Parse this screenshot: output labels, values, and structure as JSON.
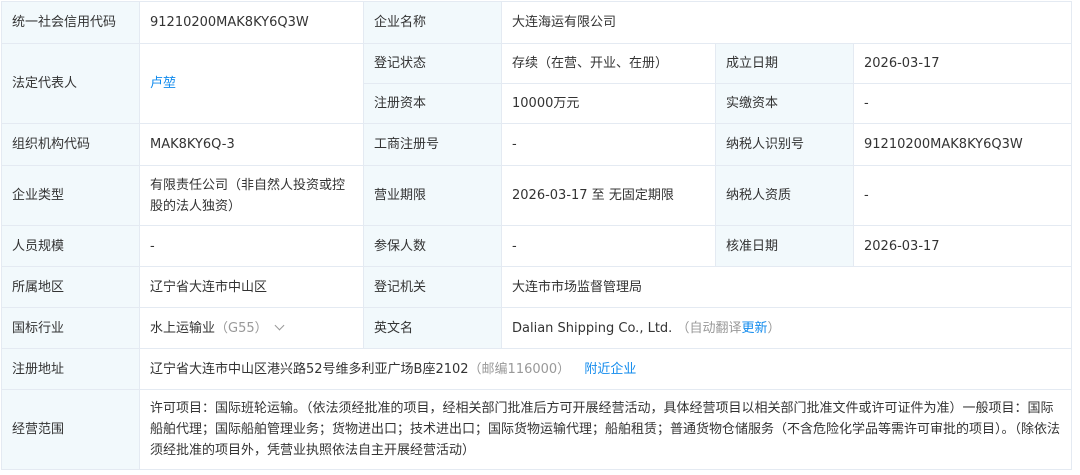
{
  "rows": {
    "credit_code": {
      "label": "统一社会信用代码",
      "value": "91210200MAK8KY6Q3W"
    },
    "company_name": {
      "label": "企业名称",
      "value": "大连海运有限公司"
    },
    "legal_rep": {
      "label": "法定代表人",
      "value": "卢堃"
    },
    "reg_status": {
      "label": "登记状态",
      "value": "存续（在营、开业、在册）"
    },
    "founded": {
      "label": "成立日期",
      "value": "2026-03-17"
    },
    "reg_capital": {
      "label": "注册资本",
      "value": "10000万元"
    },
    "paid_capital": {
      "label": "实缴资本",
      "value": "-"
    },
    "org_code": {
      "label": "组织机构代码",
      "value": "MAK8KY6Q-3"
    },
    "biz_reg_no": {
      "label": "工商注册号",
      "value": "-"
    },
    "taxpayer_id": {
      "label": "纳税人识别号",
      "value": "91210200MAK8KY6Q3W"
    },
    "company_type": {
      "label": "企业类型",
      "value": "有限责任公司（非自然人投资或控股的法人独资）"
    },
    "biz_term": {
      "label": "营业期限",
      "value": "2026-03-17 至 无固定期限"
    },
    "taxpayer_qual": {
      "label": "纳税人资质",
      "value": "-"
    },
    "staff_size": {
      "label": "人员规模",
      "value": "-"
    },
    "insured": {
      "label": "参保人数",
      "value": "-"
    },
    "approved": {
      "label": "核准日期",
      "value": "2026-03-17"
    },
    "region": {
      "label": "所属地区",
      "value": "辽宁省大连市中山区"
    },
    "reg_authority": {
      "label": "登记机关",
      "value": "大连市市场监督管理局"
    },
    "industry": {
      "label": "国标行业",
      "value": "水上运输业",
      "code": "（G55）"
    },
    "english_name": {
      "label": "英文名",
      "value": "Dalian Shipping Co., Ltd.",
      "note": "（自动翻译",
      "update_link": "更新",
      "note_close": "）"
    },
    "address": {
      "label": "注册地址",
      "value": "辽宁省大连市中山区港兴路52号维多利亚广场B座2102",
      "postcode": "（邮编116000）",
      "nearby_link": "附近企业"
    },
    "scope": {
      "label": "经营范围",
      "value": "许可项目：国际班轮运输。（依法须经批准的项目，经相关部门批准后方可开展经营活动，具体经营项目以相关部门批准文件或许可证件为准）一般项目：国际船舶代理；国际船舶管理业务；货物进出口；技术进出口；国际货物运输代理；船舶租赁；普通货物仓储服务（不含危险化学品等需许可审批的项目）。（除依法须经批准的项目外，凭营业执照依法自主开展经营活动）"
    }
  },
  "colors": {
    "label_bg": "#f2f9fc",
    "border": "#e4eaf2",
    "link": "#128bed",
    "muted": "#999999"
  },
  "icons": {
    "industry_toggle": "chevron-down-icon"
  }
}
